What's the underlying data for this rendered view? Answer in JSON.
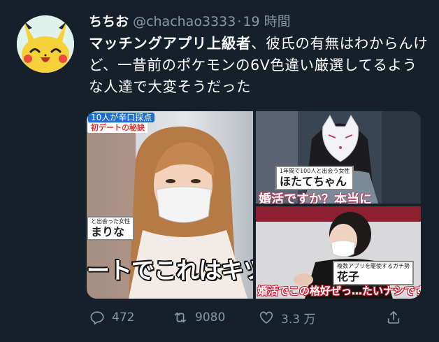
{
  "tweet": {
    "display_name": "ちちお",
    "handle": "@chachao3333",
    "separator": "·",
    "time": "19 時間",
    "highlight": "マッチングアプリ上級者",
    "text": "、彼氏の有無はわからんけど、一昔前のポケモンの6V色違い厳選してるような人達で大変そうだった"
  },
  "media": {
    "left": {
      "top_tag": "10人",
      "top_tag_rest": "が辛口採点",
      "sub_tag": "初デートの秘訣",
      "name_tag_small": "と出会った女性",
      "name_tag_big": "まりな",
      "caption": "ートでこれはキツい"
    },
    "top_right": {
      "name_tag_small": "1年間で100人と出会う女性",
      "name_tag_big": "ほたてちゃん",
      "caption": "婚活ですか？本当に"
    },
    "bottom_right": {
      "name_tag_small": "複数アプリを駆使するガチ勢",
      "name_tag_big": "花子",
      "caption": "婚活でこの格好ぜっ…たいナシです！"
    }
  },
  "actions": {
    "reply_count": "472",
    "retweet_count": "9080",
    "like_count": "3.3 万"
  },
  "colors": {
    "background": "#15202b",
    "secondary_text": "#8b98a5"
  }
}
